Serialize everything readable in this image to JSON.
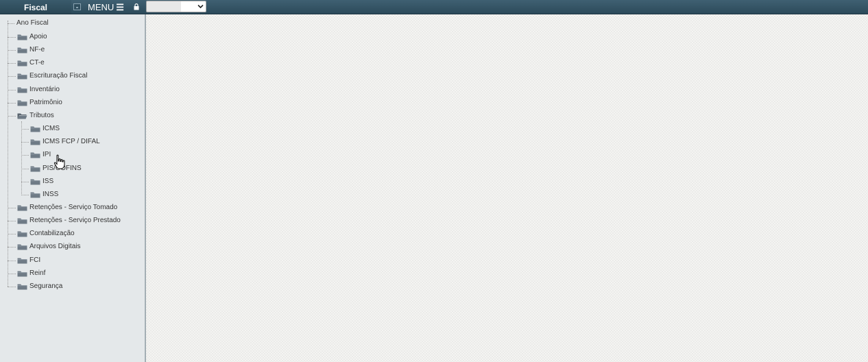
{
  "header": {
    "brand": "Fiscal",
    "menu_label": "MENU",
    "menu_icon": "hamburger-icon",
    "lock_icon": "lock-icon",
    "select": {
      "value": "",
      "icon": "chevron-down-icon"
    }
  },
  "tree": {
    "root_label": "Ano Fiscal",
    "items": [
      {
        "label": "Apoio"
      },
      {
        "label": "NF-e"
      },
      {
        "label": "CT-e"
      },
      {
        "label": "Escrituração Fiscal"
      },
      {
        "label": "Inventário"
      },
      {
        "label": "Patrimônio"
      },
      {
        "label": "Tributos",
        "expanded": true
      },
      {
        "label": "ICMS",
        "parent": "Tributos"
      },
      {
        "label": "ICMS FCP / DIFAL",
        "parent": "Tributos"
      },
      {
        "label": "IPI",
        "parent": "Tributos"
      },
      {
        "label": "PIS/COFINS",
        "parent": "Tributos"
      },
      {
        "label": "ISS",
        "parent": "Tributos"
      },
      {
        "label": "INSS",
        "parent": "Tributos"
      },
      {
        "label": "Retenções - Serviço Tomado"
      },
      {
        "label": "Retenções - Serviço Prestado"
      },
      {
        "label": "Contabilização"
      },
      {
        "label": "Arquivos Digitais"
      },
      {
        "label": "FCI"
      },
      {
        "label": "Reinf"
      },
      {
        "label": "Segurança"
      }
    ]
  },
  "colors": {
    "topbar": "#2f4d5d",
    "sidebar": "#e4e8ea",
    "folder": "#6f7b86"
  }
}
